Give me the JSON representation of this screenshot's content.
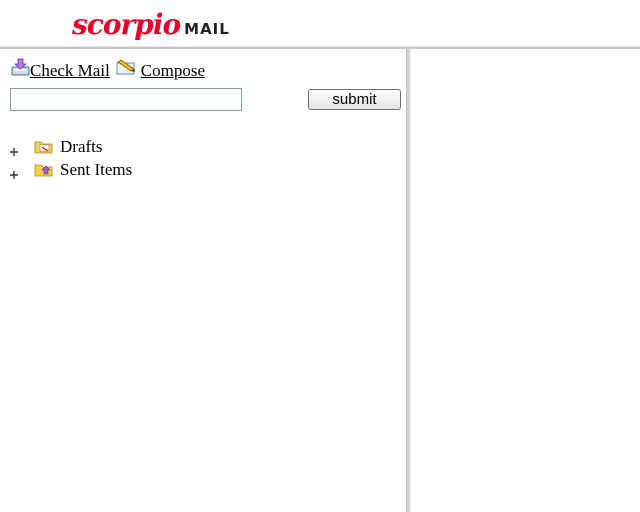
{
  "header": {
    "logo_script": "scorpio",
    "logo_mail": "MAIL"
  },
  "toolbar": {
    "check_mail_label": "Check Mail",
    "compose_label": "Compose"
  },
  "search": {
    "value": "",
    "placeholder": "",
    "submit_label": "submit"
  },
  "folders": [
    {
      "label": "Drafts",
      "icon": "drafts-folder-icon"
    },
    {
      "label": "Sent Items",
      "icon": "sent-items-folder-icon"
    }
  ],
  "colors": {
    "logo_red": "#e8002a",
    "folder_yellow": "#f4d04a",
    "divider_gray": "#d4d4d4"
  }
}
